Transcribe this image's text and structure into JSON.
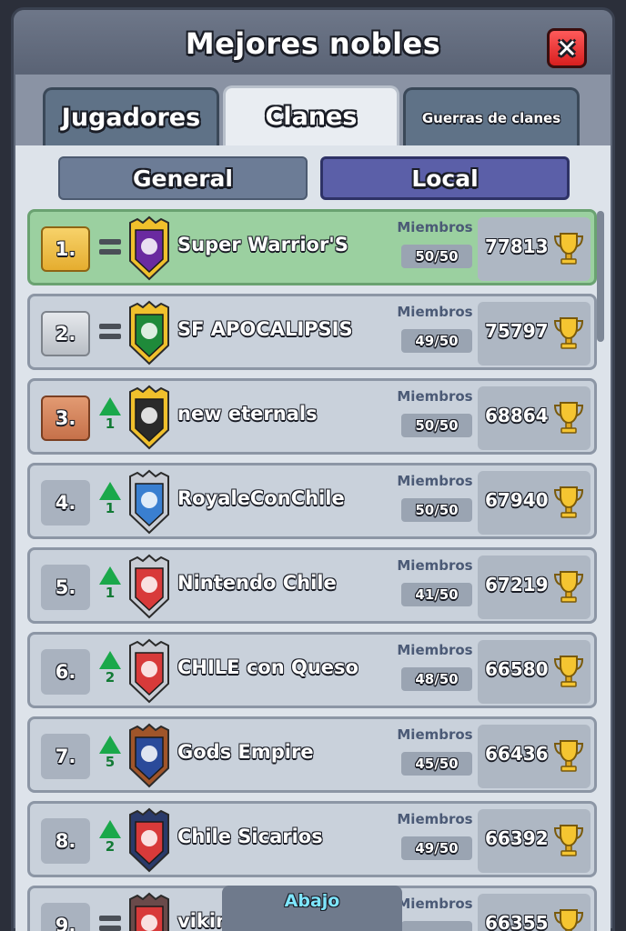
{
  "header": {
    "title": "Mejores nobles",
    "close_icon": "close-icon"
  },
  "tabs": [
    {
      "label": "Jugadores",
      "active": false
    },
    {
      "label": "Clanes",
      "active": true
    },
    {
      "label": "Guerras de clanes",
      "active": false
    }
  ],
  "filters": {
    "general": "General",
    "local": "Local",
    "selected": "Local"
  },
  "labels": {
    "members": "Miembros",
    "bottom": "Abajo"
  },
  "clans": [
    {
      "rank": "1.",
      "trend": "equal",
      "trend_num": "",
      "name": "Super Warrior'S",
      "members": "50/50",
      "trophies": "77813",
      "badge_color": "#f0c02c",
      "badge_inner": "#6a2aa0",
      "badge_icon": "skull-icon",
      "rank_style": "gold",
      "highlight": true
    },
    {
      "rank": "2.",
      "trend": "equal",
      "trend_num": "",
      "name": "SF APOCALIPSIS",
      "members": "49/50",
      "trophies": "75797",
      "badge_color": "#f0c02c",
      "badge_inner": "#1f8a3a",
      "badge_icon": "jamaica-flag-icon",
      "rank_style": "silver",
      "highlight": false
    },
    {
      "rank": "3.",
      "trend": "up",
      "trend_num": "1",
      "name": "new eternals",
      "members": "50/50",
      "trophies": "68864",
      "badge_color": "#f0c02c",
      "badge_inner": "#2a2a2a",
      "badge_icon": "flame-icon",
      "rank_style": "bronze",
      "highlight": false
    },
    {
      "rank": "4.",
      "trend": "up",
      "trend_num": "1",
      "name": "RoyaleConChile",
      "members": "50/50",
      "trophies": "67940",
      "badge_color": "#c8ccd4",
      "badge_inner": "#3a7fd0",
      "badge_icon": "crown-icon",
      "rank_style": "plain",
      "highlight": false
    },
    {
      "rank": "5.",
      "trend": "up",
      "trend_num": "1",
      "name": "Nintendo Chile",
      "members": "41/50",
      "trophies": "67219",
      "badge_color": "#c8ccd4",
      "badge_inner": "#d83a3a",
      "badge_icon": "star-icon",
      "rank_style": "plain",
      "highlight": false
    },
    {
      "rank": "6.",
      "trend": "up",
      "trend_num": "2",
      "name": "CHILE con Queso",
      "members": "48/50",
      "trophies": "66580",
      "badge_color": "#c8ccd4",
      "badge_inner": "#d83a3a",
      "badge_icon": "star-icon",
      "rank_style": "plain",
      "highlight": false
    },
    {
      "rank": "7.",
      "trend": "up",
      "trend_num": "5",
      "name": "Gods Empire",
      "members": "45/50",
      "trophies": "66436",
      "badge_color": "#a0552a",
      "badge_inner": "#2a4a9a",
      "badge_icon": "lightning-icon",
      "rank_style": "plain",
      "highlight": false
    },
    {
      "rank": "8.",
      "trend": "up",
      "trend_num": "2",
      "name": "Chile Sicarios",
      "members": "49/50",
      "trophies": "66392",
      "badge_color": "#2a3a6a",
      "badge_inner": "#d83a3a",
      "badge_icon": "sword-icon",
      "rank_style": "plain",
      "highlight": false
    },
    {
      "rank": "9.",
      "trend": "equal",
      "trend_num": "",
      "name": "vikingos",
      "members": "",
      "trophies": "66355",
      "badge_color": "#6a4a4a",
      "badge_inner": "#d83a3a",
      "badge_icon": "shield-icon",
      "rank_style": "plain",
      "highlight": false
    }
  ],
  "colors": {
    "accent": "#5b5fa8",
    "highlight_row": "#9bd0a0",
    "trend_up": "#1aa84a"
  }
}
